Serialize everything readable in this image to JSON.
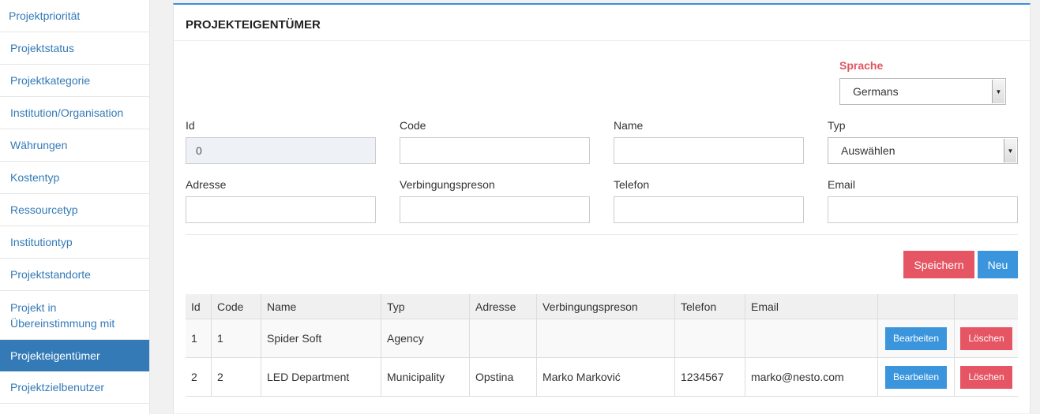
{
  "sidebar": {
    "items": [
      {
        "label": "Projektpriorität"
      },
      {
        "label": "Projektstatus"
      },
      {
        "label": "Projektkategorie"
      },
      {
        "label": "Institution/Organisation"
      },
      {
        "label": "Währungen"
      },
      {
        "label": "Kostentyp"
      },
      {
        "label": "Ressourcetyp"
      },
      {
        "label": "Institutiontyp"
      },
      {
        "label": "Projektstandorte"
      },
      {
        "label": "Projekt in Übereinstimmung mit"
      },
      {
        "label": "Projekteigentümer",
        "active": true
      },
      {
        "label": "Projektzielbenutzer"
      }
    ]
  },
  "panel": {
    "title": "PROJEKTEIGENTÜMER"
  },
  "language": {
    "label": "Sprache",
    "selected": "Germans"
  },
  "form": {
    "id": {
      "label": "Id",
      "value": "0"
    },
    "code": {
      "label": "Code",
      "value": ""
    },
    "name": {
      "label": "Name",
      "value": ""
    },
    "typ": {
      "label": "Typ",
      "selected": "Auswählen"
    },
    "adresse": {
      "label": "Adresse",
      "value": ""
    },
    "contact": {
      "label": "Verbingungspreson",
      "value": ""
    },
    "telefon": {
      "label": "Telefon",
      "value": ""
    },
    "email": {
      "label": "Email",
      "value": ""
    }
  },
  "buttons": {
    "save": "Speichern",
    "new": "Neu"
  },
  "table": {
    "headers": [
      "Id",
      "Code",
      "Name",
      "Typ",
      "Adresse",
      "Verbingungspreson",
      "Telefon",
      "Email",
      "",
      ""
    ],
    "rows": [
      {
        "id": "1",
        "code": "1",
        "name": "Spider Soft",
        "typ": "Agency",
        "adresse": "",
        "contact": "",
        "telefon": "",
        "email": "",
        "edit": "Bearbeiten",
        "delete": "Löschen"
      },
      {
        "id": "2",
        "code": "2",
        "name": "LED Department",
        "typ": "Municipality",
        "adresse": "Opstina",
        "contact": "Marko Marković",
        "telefon": "1234567",
        "email": "marko@nesto.com",
        "edit": "Bearbeiten",
        "delete": "Löschen"
      }
    ]
  },
  "colors": {
    "primary": "#337ab7",
    "danger": "#e55563",
    "info": "#3a95dd",
    "accent_label": "#e05560"
  }
}
